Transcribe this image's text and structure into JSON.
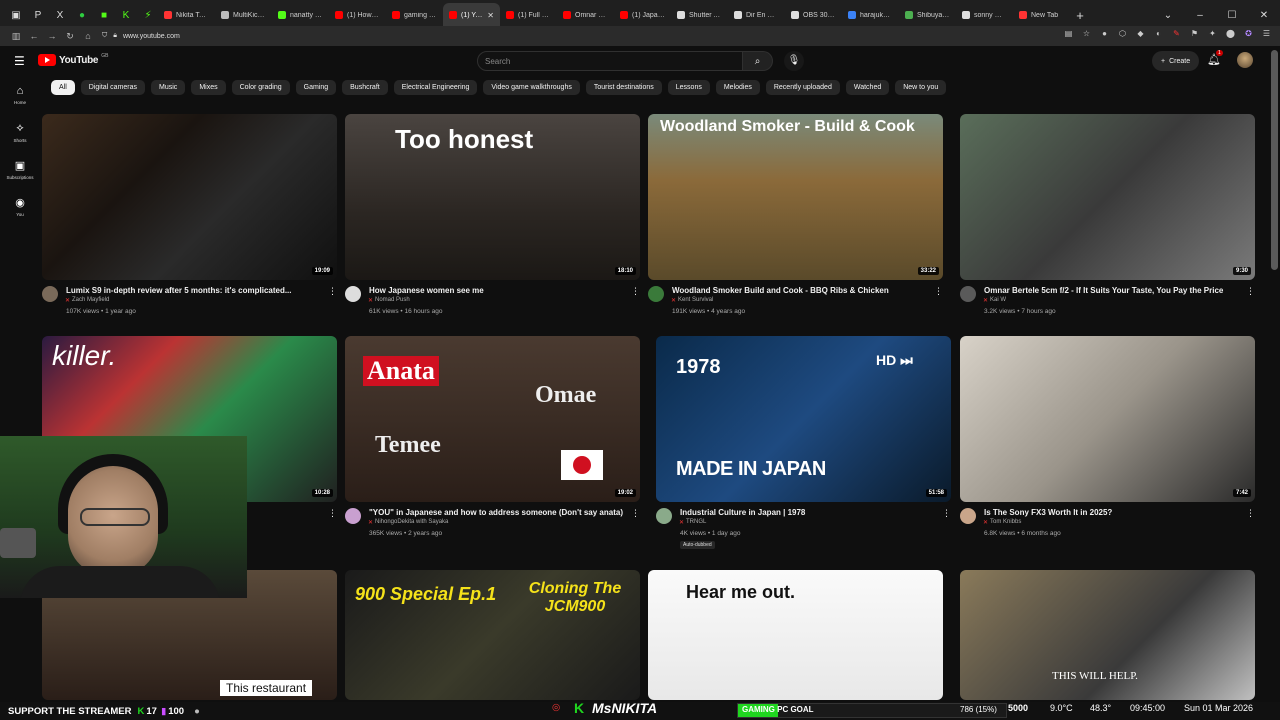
{
  "browser": {
    "tabs": [
      {
        "label": "Nikita Tachib",
        "color": "#ff3333"
      },
      {
        "label": "MultiKick.com",
        "color": "#bbbbbb"
      },
      {
        "label": "nanatty Strea",
        "color": "#53fc18"
      },
      {
        "label": "(1) How to P",
        "color": "#ff0000"
      },
      {
        "label": "gaming ivent",
        "color": "#ff0000"
      },
      {
        "label": "(1) YouTu",
        "color": "#ff0000",
        "active": true
      },
      {
        "label": "(1) Full Fram",
        "color": "#ff0000"
      },
      {
        "label": "Omnar Bertel",
        "color": "#ff0000"
      },
      {
        "label": "(1) Japanese",
        "color": "#ff0000"
      },
      {
        "label": "Shutter Angl",
        "color": "#dddddd"
      },
      {
        "label": "Dir En Grey",
        "color": "#dddddd"
      },
      {
        "label": "OBS 30.0.2 r",
        "color": "#dddddd"
      },
      {
        "label": "harajuku | Fa",
        "color": "#3b82f6"
      },
      {
        "label": "Shibuya, Toky",
        "color": "#4caf50"
      },
      {
        "label": "sonny mdr-v",
        "color": "#dddddd"
      },
      {
        "label": "New Tab",
        "color": "#ff3333"
      }
    ],
    "url": "www.youtube.com"
  },
  "header": {
    "logo": "YouTube",
    "logo_country": "GB",
    "search_placeholder": "Search",
    "create_label": "Create",
    "notification_count": "1"
  },
  "sidebar": [
    {
      "label": "Home",
      "icon": "home-icon"
    },
    {
      "label": "Shorts",
      "icon": "shorts-icon"
    },
    {
      "label": "Subscriptions",
      "icon": "subscriptions-icon"
    },
    {
      "label": "You",
      "icon": "you-icon"
    }
  ],
  "chips": [
    "All",
    "Digital cameras",
    "Music",
    "Mixes",
    "Color grading",
    "Gaming",
    "Bushcraft",
    "Electrical Engineering",
    "Video game walkthroughs",
    "Tourist destinations",
    "Lessons",
    "Melodies",
    "Recently uploaded",
    "Watched",
    "New to you"
  ],
  "videos": [
    {
      "title": "Lumix S9 in-depth review after 5 months: it's complicated...",
      "channel": "Zach Mayfield",
      "stats": "107K views • 1 year ago",
      "duration": "19:09"
    },
    {
      "title": "How Japanese women see me",
      "channel": "Nomad Push",
      "stats": "61K views • 16 hours ago",
      "duration": "18:10",
      "overlay": "Too honest"
    },
    {
      "title": "Woodland Smoker Build and Cook - BBQ Ribs & Chicken",
      "channel": "Kent Survival",
      "stats": "191K views • 4 years ago",
      "duration": "33:22",
      "overlay": "Woodland Smoker - Build & Cook"
    },
    {
      "title": "Omnar Bertele 5cm f/2 - If It Suits Your Taste, You Pay the Price",
      "channel": "Kai W",
      "stats": "3.2K views • 7 hours ago",
      "duration": "9:30"
    },
    {
      "title": "",
      "channel": "",
      "stats": "",
      "duration": "10:28",
      "overlay": "killer."
    },
    {
      "title": "\"YOU\" in Japanese and how to address someone (Don't say anata)",
      "channel": "NihongoDekita with Sayaka",
      "stats": "365K views • 2 years ago",
      "duration": "19:02",
      "overlay": "Anata",
      "overlay2": "Omae",
      "overlay3": "Temee"
    },
    {
      "title": "Industrial Culture in Japan | 1978",
      "channel": "TRNGL",
      "stats": "4K views • 1 day ago",
      "duration": "51:58",
      "overlay": "1978",
      "overlay2": "MADE IN JAPAN",
      "badge": "Auto-dubbed"
    },
    {
      "title": "Is The Sony FX3 Worth It in 2025?",
      "channel": "Tom Knibbs",
      "stats": "6.8K views • 6 months ago",
      "duration": "7:42"
    },
    {
      "title": "",
      "channel": "",
      "stats": "",
      "duration": "",
      "overlay": "This restaurant"
    },
    {
      "title": "",
      "channel": "",
      "stats": "",
      "duration": "",
      "overlay": "900 Special Ep.1",
      "overlay2": "Cloning The JCM900"
    },
    {
      "title": "",
      "channel": "",
      "stats": "",
      "duration": "",
      "overlay": "Hear me out."
    },
    {
      "title": "",
      "channel": "",
      "stats": "",
      "duration": "",
      "overlay": "THIS WILL HELP."
    }
  ],
  "stream": {
    "ticker_left": "SUPPORT THE STREAMER",
    "kick_count": "17",
    "count2": "100",
    "brand_k": "K",
    "brand_name": "MsNIKITA",
    "goal_label": "GAMING PC GOAL",
    "goal_amount": "786 (15%)",
    "goal_fraction": 0.15,
    "stat1": "5000",
    "weather": "9.0°C",
    "humidity": "48.3°",
    "time": "09:45:00",
    "date": "Sun 01 Mar 2026"
  }
}
